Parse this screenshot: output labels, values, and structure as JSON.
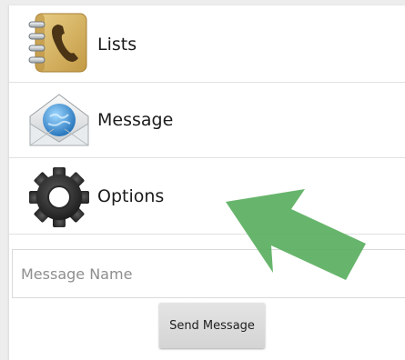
{
  "menu": {
    "items": [
      {
        "label": "Lists",
        "icon": "address-book-icon"
      },
      {
        "label": "Message",
        "icon": "envelope-icon"
      },
      {
        "label": "Options",
        "icon": "gear-icon"
      }
    ]
  },
  "message_form": {
    "name_placeholder": "Message Name",
    "name_value": "",
    "send_label": "Send Message"
  },
  "overlay": {
    "arrow_icon": "pointer-arrow-icon",
    "arrow_color": "#5aaf5f"
  }
}
